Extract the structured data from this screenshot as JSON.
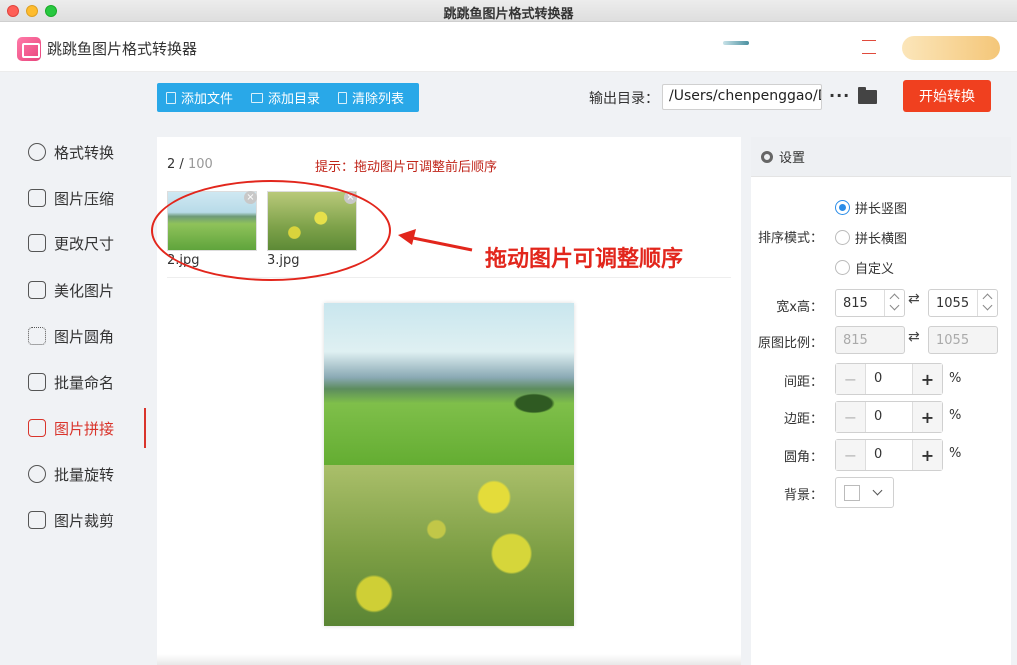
{
  "window": {
    "title": "跳跳鱼图片格式转换器"
  },
  "app": {
    "name": "跳跳鱼图片格式转换器"
  },
  "sidebar": {
    "items": [
      {
        "label": "格式转换",
        "icon": "format-convert-icon"
      },
      {
        "label": "图片压缩",
        "icon": "compress-icon"
      },
      {
        "label": "更改尺寸",
        "icon": "resize-icon"
      },
      {
        "label": "美化图片",
        "icon": "beautify-icon"
      },
      {
        "label": "图片圆角",
        "icon": "rounded-corner-icon"
      },
      {
        "label": "批量命名",
        "icon": "rename-icon"
      },
      {
        "label": "图片拼接",
        "icon": "stitch-icon",
        "active": true
      },
      {
        "label": "批量旋转",
        "icon": "rotate-icon"
      },
      {
        "label": "图片裁剪",
        "icon": "crop-icon"
      }
    ]
  },
  "toolbar": {
    "add_file": "添加文件",
    "add_dir": "添加目录",
    "clear_list": "清除列表",
    "output_label": "输出目录：",
    "output_path": "/Users/chenpenggao/D",
    "more": "···",
    "start": "开始转换"
  },
  "main": {
    "count_current": "2",
    "count_separator": " / ",
    "count_total": "100",
    "tip": "提示：拖动图片可调整前后顺序",
    "thumbnails": [
      {
        "name": "2.jpg"
      },
      {
        "name": "3.jpg"
      }
    ],
    "annotation": "拖动图片可调整顺序"
  },
  "settings": {
    "header": "设置",
    "sort_label": "排序模式：",
    "sort_options": [
      "拼长竖图",
      "拼长横图",
      "自定义"
    ],
    "sort_selected": "拼长竖图",
    "size_label": "宽x高：",
    "width": "815",
    "height": "1055",
    "ratio_label": "原图比例：",
    "ratio_width": "815",
    "ratio_height": "1055",
    "spacing_label": "间距：",
    "spacing": "0",
    "margin_label": "边距：",
    "margin": "0",
    "corner_label": "圆角：",
    "corner": "0",
    "percent": "%",
    "background_label": "背景：",
    "background_color": "#ffffff"
  },
  "colors": {
    "accent_red": "#d9342b",
    "toolbar_blue": "#29a8e8",
    "start_button": "#f0401f",
    "annotation_red": "#e2261c"
  }
}
